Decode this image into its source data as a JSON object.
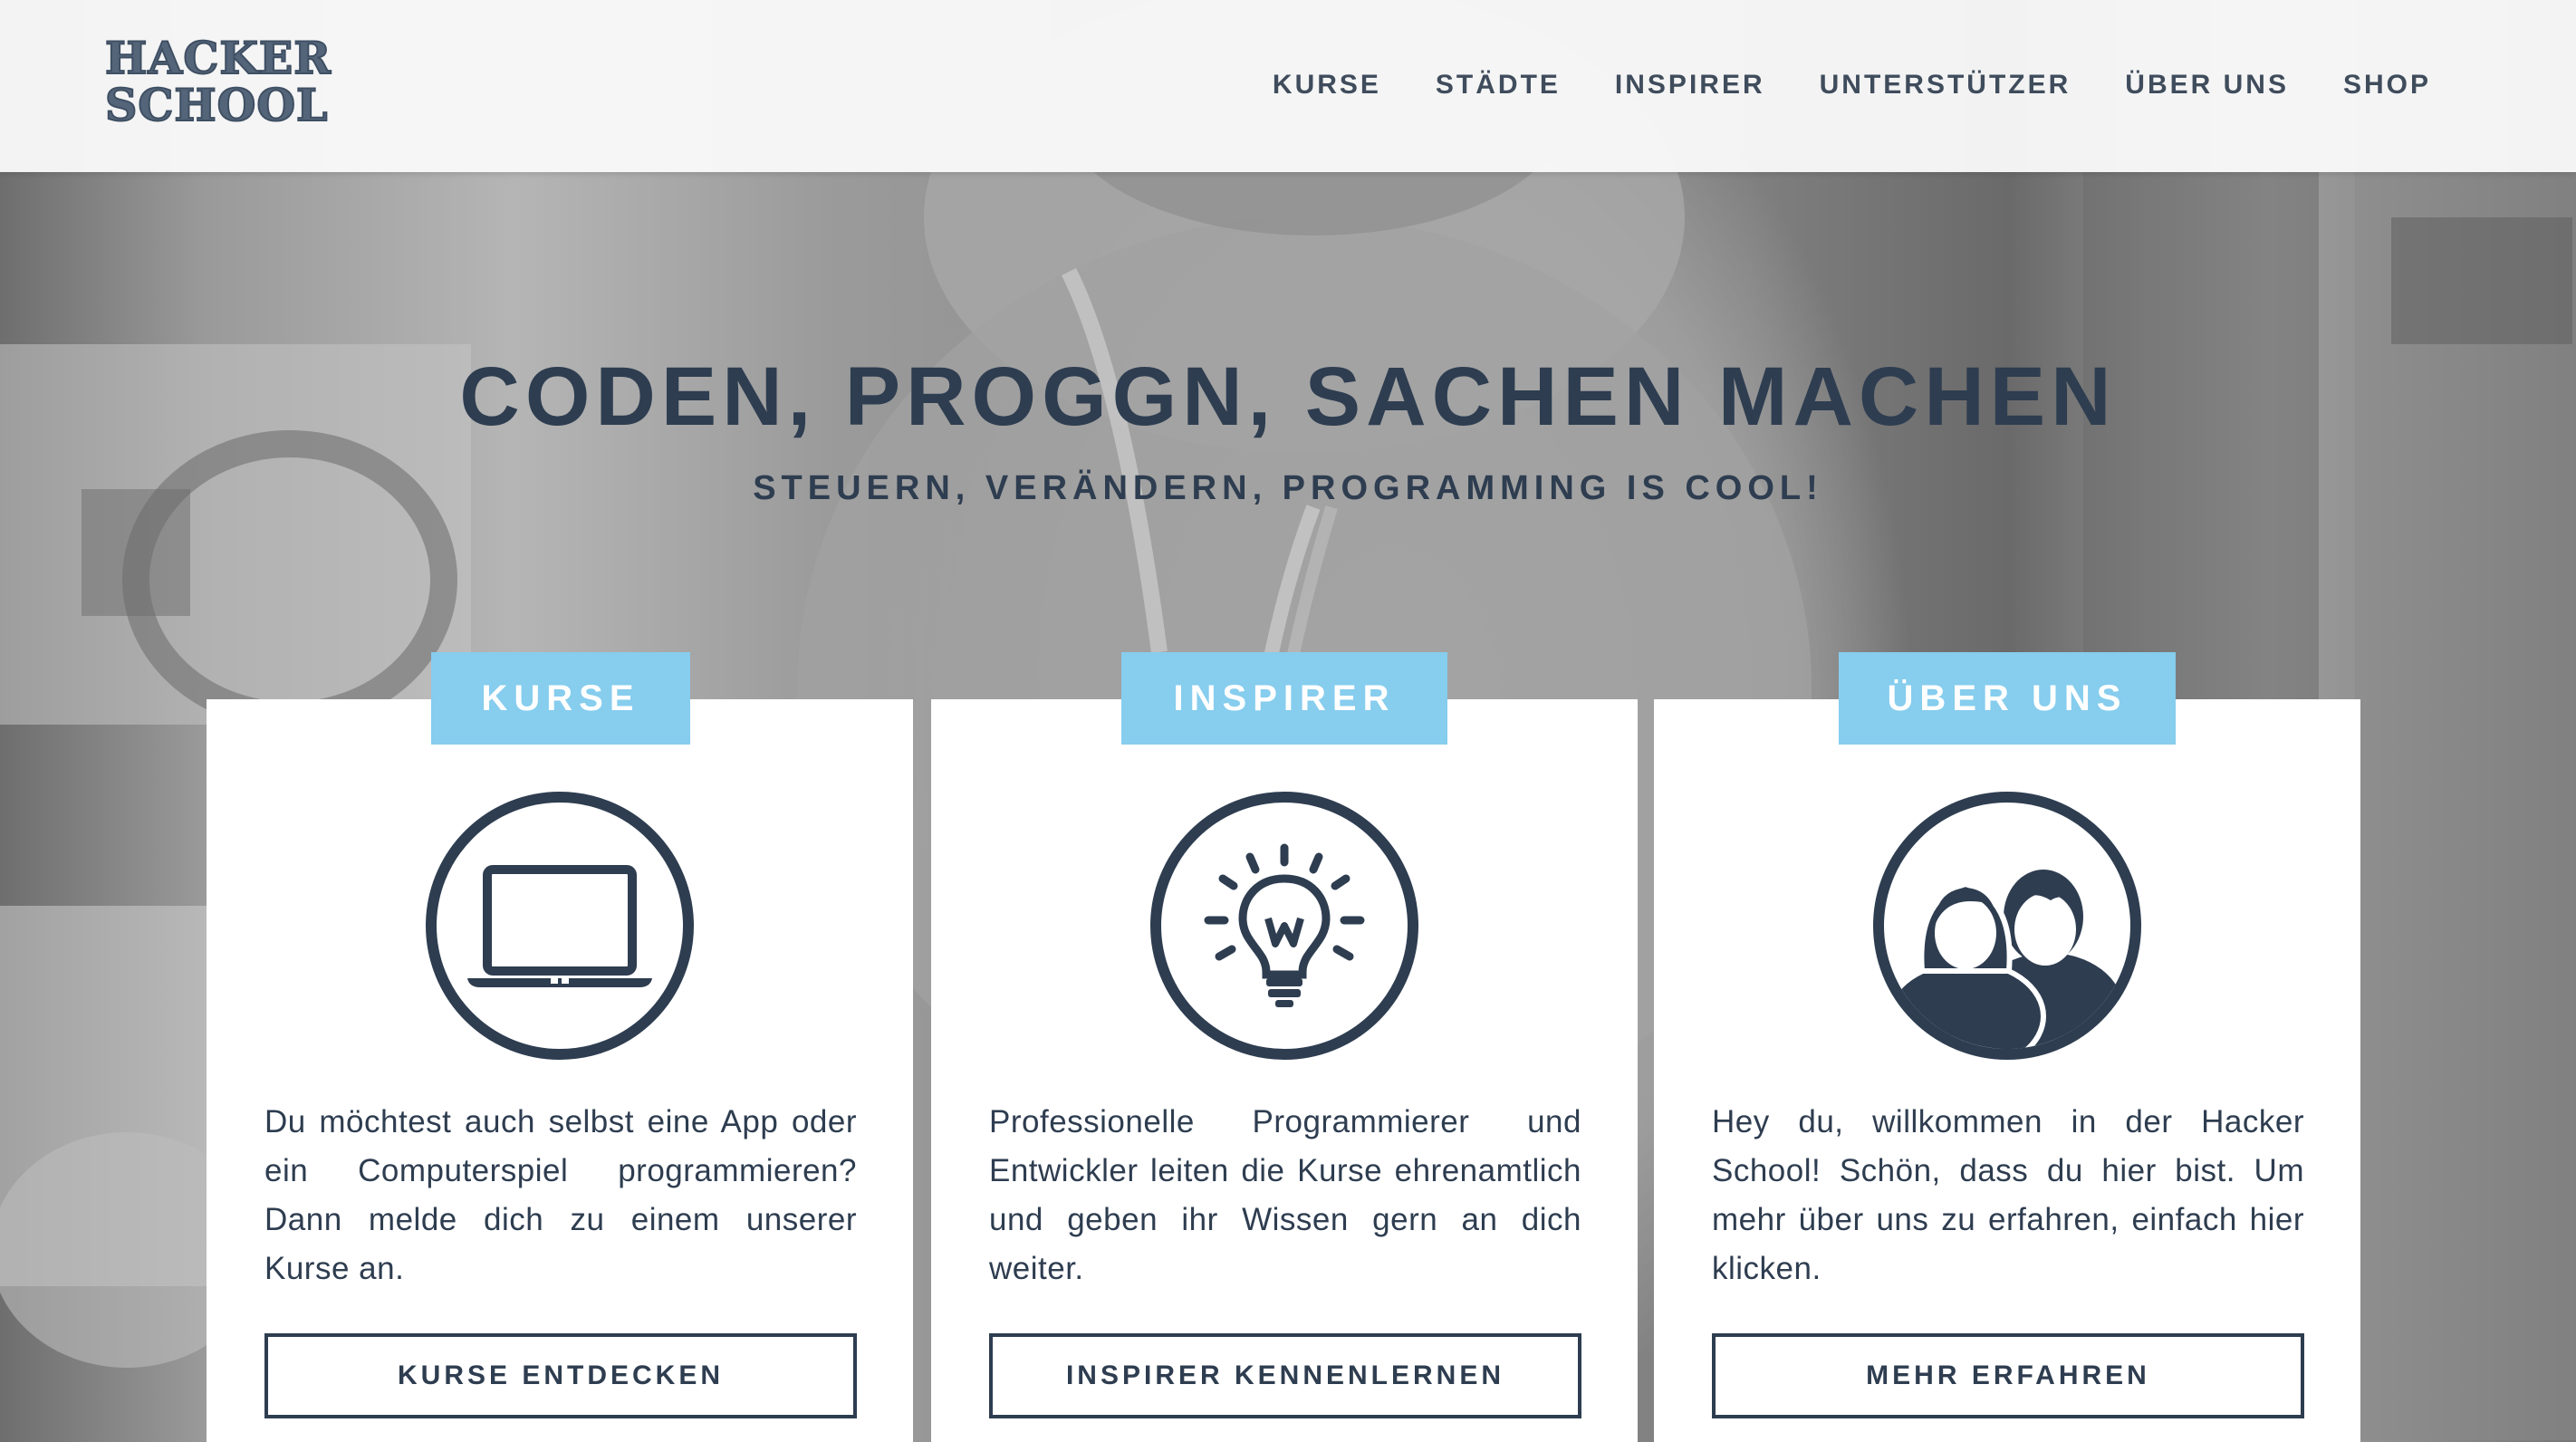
{
  "header": {
    "logo_line1": "HACKER",
    "logo_line2": "SCHOOL",
    "nav": [
      {
        "label": "KURSE"
      },
      {
        "label": "STÄDTE"
      },
      {
        "label": "INSPIRER"
      },
      {
        "label": "UNTERSTÜTZER"
      },
      {
        "label": "ÜBER UNS"
      },
      {
        "label": "SHOP"
      }
    ]
  },
  "hero": {
    "title": "CODEN, PROGGN, SACHEN MACHEN",
    "subtitle": "STEUERN, VERÄNDERN, PROGRAMMING IS COOL!"
  },
  "cards": [
    {
      "tab": "KURSE",
      "icon": "laptop-icon",
      "text": "Du möchtest auch selbst eine App oder ein Computerspiel programmieren? Dann melde dich zu einem unserer Kurse an.",
      "button": "KURSE ENTDECKEN"
    },
    {
      "tab": "INSPIRER",
      "icon": "lightbulb-icon",
      "text": "Professionelle Programmierer und Entwickler leiten die Kurse ehrenamtlich und geben ihr Wissen gern an dich weiter.",
      "button": "INSPIRER KENNENLERNEN"
    },
    {
      "tab": "ÜBER UNS",
      "icon": "people-icon",
      "text": "Hey du, willkommen in der Hacker School! Schön, dass du hier bist. Um mehr über uns zu erfahren, einfach hier klicken.",
      "button": "MEHR ERFAHREN"
    }
  ],
  "colors": {
    "primary": "#2e3d50",
    "accent": "#86cdee",
    "header_bg": "#fafafa",
    "card_bg": "#ffffff"
  }
}
